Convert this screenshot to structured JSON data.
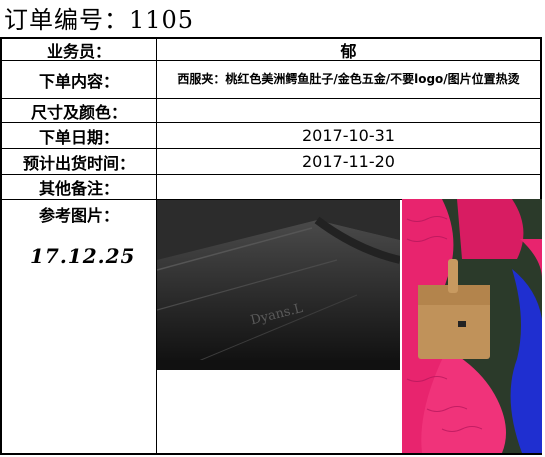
{
  "order_title": "订单编号：1105",
  "rows": [
    {
      "label": "业务员：",
      "value": "郁"
    },
    {
      "label": "下单内容：",
      "value": "西服夹：桃红色美洲鳄鱼肚子/金色五金/不要logo/图片位置热烫"
    },
    {
      "label": "尺寸及颜色：",
      "value": ""
    },
    {
      "label": "下单日期：",
      "value": "2017-10-31"
    },
    {
      "label": "预计出货时间：",
      "value": "2017-11-20"
    },
    {
      "label": "其他备注：",
      "value": ""
    }
  ],
  "reference": {
    "label": "参考图片：",
    "handwritten_date": "17.12.25",
    "photo1_embossed_text": "Dyans.L"
  },
  "colors": {
    "pink_leather": "#e8246e",
    "tan_wallet": "#c0925a",
    "black_leather": "#1a1a1a",
    "blue_leather": "#1f2fd0"
  }
}
